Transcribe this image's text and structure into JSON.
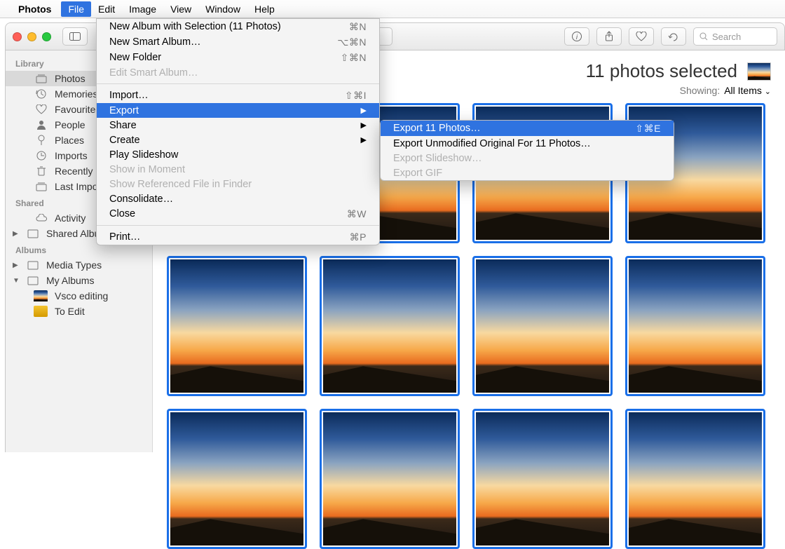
{
  "menubar": {
    "app_name": "Photos",
    "items": [
      "File",
      "Edit",
      "Image",
      "View",
      "Window",
      "Help"
    ],
    "active_index": 0
  },
  "toolbar": {
    "search_placeholder": "Search"
  },
  "sidebar": {
    "sections": [
      {
        "header": "Library",
        "items": [
          {
            "icon": "stack",
            "label": "Photos",
            "selected": true
          },
          {
            "icon": "clock",
            "label": "Memories"
          },
          {
            "icon": "heart",
            "label": "Favourites"
          },
          {
            "icon": "person",
            "label": "People"
          },
          {
            "icon": "pin",
            "label": "Places"
          },
          {
            "icon": "clock2",
            "label": "Imports"
          },
          {
            "icon": "trash",
            "label": "Recently D"
          },
          {
            "icon": "stack2",
            "label": "Last Impor"
          }
        ]
      },
      {
        "header": "Shared",
        "items": [
          {
            "icon": "cloud",
            "label": "Activity"
          },
          {
            "icon": "album",
            "label": "Shared Albums",
            "disclosure": "right"
          }
        ]
      },
      {
        "header": "Albums",
        "items": [
          {
            "icon": "album",
            "label": "Media Types",
            "disclosure": "right"
          },
          {
            "icon": "album",
            "label": "My Albums",
            "disclosure": "down",
            "children": [
              {
                "icon": "thumb",
                "label": "Vsco editing"
              },
              {
                "icon": "thumb-yel",
                "label": "To Edit"
              }
            ]
          }
        ]
      }
    ]
  },
  "header": {
    "title": "11 photos selected",
    "showing_label": "Showing:",
    "showing_value": "All Items"
  },
  "file_menu": {
    "items": [
      {
        "label": "New Album with Selection (11 Photos)",
        "shortcut": "⌘N"
      },
      {
        "label": "New Smart Album…",
        "shortcut": "⌥⌘N"
      },
      {
        "label": "New Folder",
        "shortcut": "⇧⌘N"
      },
      {
        "label": "Edit Smart Album…",
        "disabled": true
      },
      {
        "sep": true
      },
      {
        "label": "Import…",
        "shortcut": "⇧⌘I"
      },
      {
        "label": "Export",
        "submenu": true,
        "highlighted": true
      },
      {
        "label": "Share",
        "submenu": true
      },
      {
        "label": "Create",
        "submenu": true
      },
      {
        "label": "Play Slideshow"
      },
      {
        "label": "Show in Moment",
        "disabled": true
      },
      {
        "label": "Show Referenced File in Finder",
        "disabled": true
      },
      {
        "label": "Consolidate…"
      },
      {
        "label": "Close",
        "shortcut": "⌘W"
      },
      {
        "sep": true
      },
      {
        "label": "Print…",
        "shortcut": "⌘P"
      }
    ]
  },
  "export_submenu": {
    "items": [
      {
        "label": "Export 11 Photos…",
        "shortcut": "⇧⌘E",
        "highlighted": true
      },
      {
        "label": "Export Unmodified Original For 11 Photos…"
      },
      {
        "label": "Export Slideshow…",
        "disabled": true
      },
      {
        "label": "Export GIF",
        "disabled": true
      }
    ]
  }
}
